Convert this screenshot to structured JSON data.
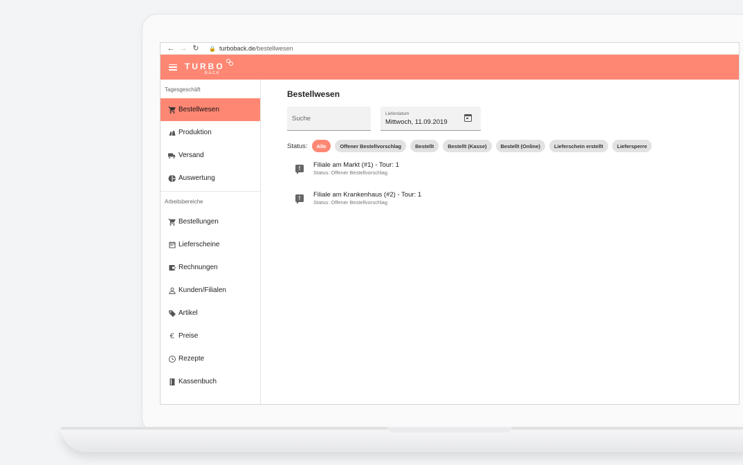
{
  "browser": {
    "back_icon": "arrow-left-icon",
    "forward_icon": "arrow-right-icon",
    "reload_icon": "reload-icon",
    "url_host": "turboback.de",
    "url_path": "/bestellwesen"
  },
  "appbar": {
    "logo_main": "TURBO",
    "logo_sub": "BACK",
    "color": "#fe8774"
  },
  "sidebar": {
    "section1_label": "Tagesgeschäft",
    "section1_items": [
      {
        "label": "Bestellwesen",
        "icon": "cart-icon",
        "active": true
      },
      {
        "label": "Produktion",
        "icon": "production-icon"
      },
      {
        "label": "Versand",
        "icon": "truck-icon"
      },
      {
        "label": "Auswertung",
        "icon": "pie-chart-icon"
      }
    ],
    "section2_label": "Arbeitsbereiche",
    "section2_items": [
      {
        "label": "Bestellungen",
        "icon": "cart-icon"
      },
      {
        "label": "Lieferscheine",
        "icon": "calendar-icon"
      },
      {
        "label": "Rechnungen",
        "icon": "wallet-icon"
      },
      {
        "label": "Kunden/Filialen",
        "icon": "person-icon"
      },
      {
        "label": "Artikel",
        "icon": "tag-icon"
      },
      {
        "label": "Preise",
        "icon": "euro-icon"
      },
      {
        "label": "Rezepte",
        "icon": "clock-icon"
      },
      {
        "label": "Kassenbuch",
        "icon": "book-icon"
      }
    ]
  },
  "main": {
    "title": "Bestellwesen",
    "search_placeholder": "Suche",
    "date_label": "Lieferdatum",
    "date_value": "Mittwoch, 11.09.2019",
    "status_label": "Status:",
    "chips": [
      {
        "label": "Alle",
        "active": true
      },
      {
        "label": "Offener Bestellvorschlag"
      },
      {
        "label": "Bestellt"
      },
      {
        "label": "Bestellt (Kasse)"
      },
      {
        "label": "Bestellt (Online)"
      },
      {
        "label": "Lieferschein erstellt"
      },
      {
        "label": "Liefersperre"
      }
    ],
    "orders": [
      {
        "title": "Filiale am Markt (#1) - Tour: 1",
        "status": "Status: Offener Bestellvorschlag"
      },
      {
        "title": "Filiale am Krankenhaus (#2) - Tour: 1",
        "status": "Status: Offener Bestellvorschlag"
      }
    ]
  }
}
